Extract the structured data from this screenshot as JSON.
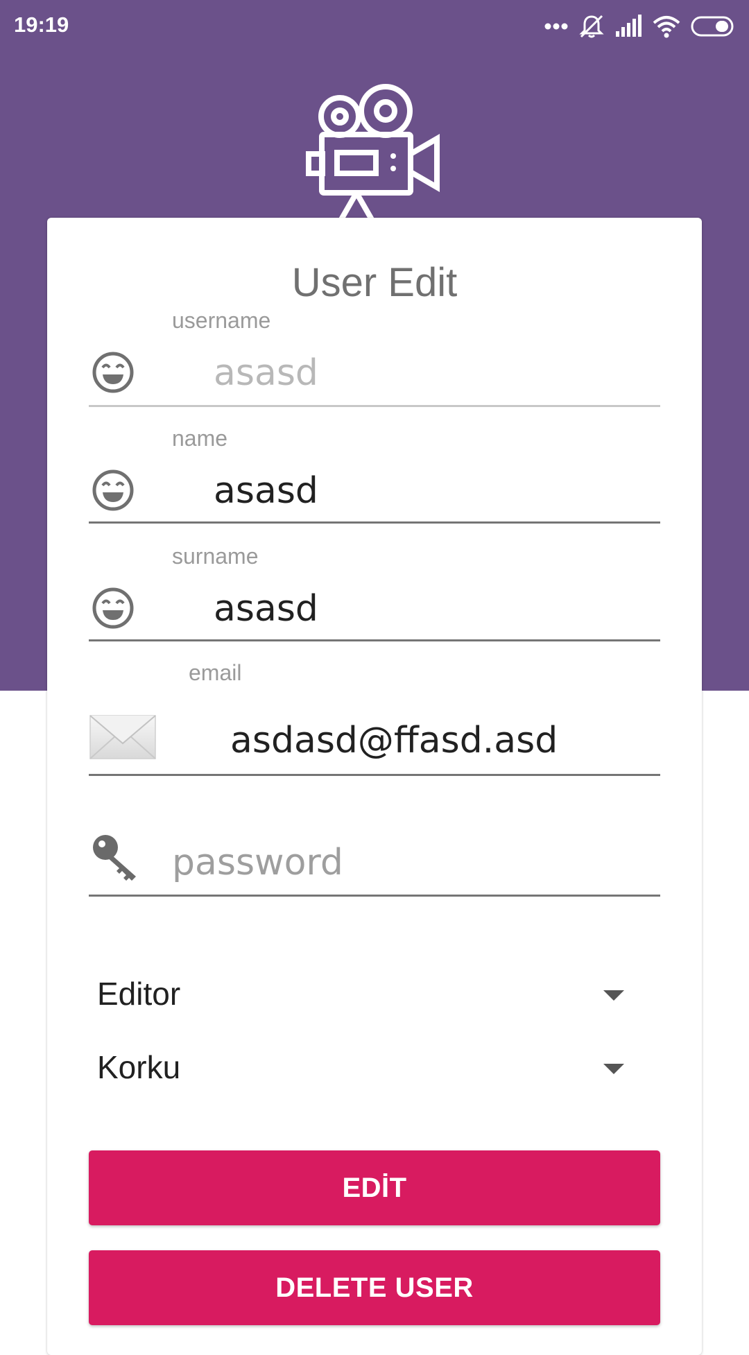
{
  "status_bar": {
    "time": "19:19",
    "icons": [
      "more-dots-icon",
      "notifications-off-icon",
      "signal-icon",
      "wifi-icon",
      "battery-icon"
    ]
  },
  "logo": {
    "icon": "movie-camera-icon"
  },
  "card": {
    "title": "User Edit"
  },
  "fields": {
    "username": {
      "label": "username",
      "value": "asasd",
      "icon": "smiley-icon"
    },
    "name": {
      "label": "name",
      "value": "asasd",
      "icon": "smiley-icon"
    },
    "surname": {
      "label": "surname",
      "value": "asasd",
      "icon": "smiley-icon"
    },
    "email": {
      "label": "email",
      "value": "asdasd@ffasd.asd",
      "icon": "envelope-icon"
    },
    "password": {
      "placeholder": "password",
      "value": "",
      "icon": "key-icon"
    }
  },
  "spinners": {
    "role": {
      "selected": "Editor"
    },
    "genre": {
      "selected": "Korku"
    }
  },
  "buttons": {
    "edit": "EDİT",
    "delete": "DELETE USER"
  },
  "colors": {
    "header_purple": "#6b518a",
    "accent_pink": "#d81b60",
    "title_gray": "#707070",
    "label_gray": "#9a9a9a"
  }
}
